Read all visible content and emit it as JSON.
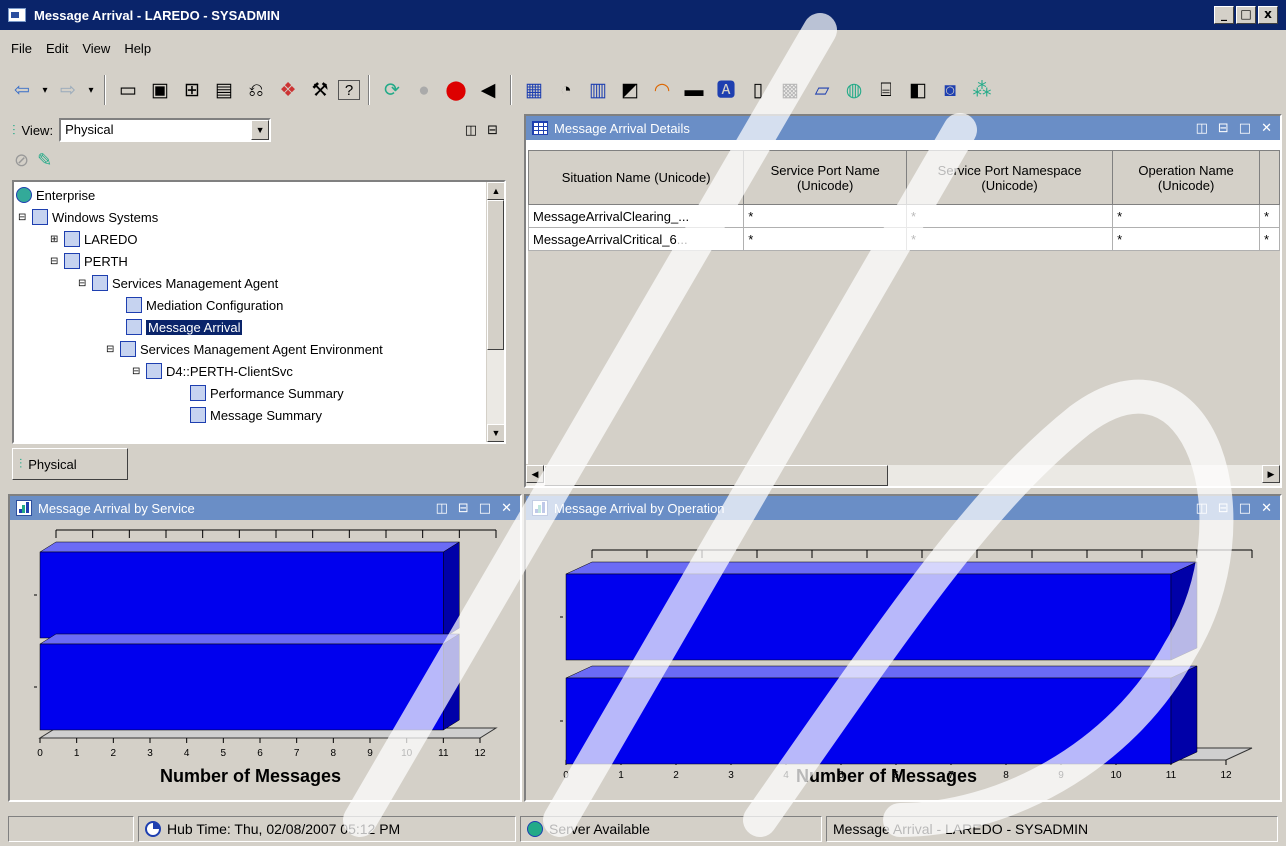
{
  "window": {
    "title": "Message Arrival - LAREDO - SYSADMIN",
    "controls": [
      "_",
      "□",
      "x"
    ]
  },
  "menu": [
    "File",
    "Edit",
    "View",
    "Help"
  ],
  "navigator": {
    "view_label": "View:",
    "view_value": "Physical",
    "tab_label": "Physical",
    "tree": [
      {
        "label": "Enterprise",
        "level": 0
      },
      {
        "label": "Windows Systems",
        "level": 1
      },
      {
        "label": "LAREDO",
        "level": 2
      },
      {
        "label": "PERTH",
        "level": 2
      },
      {
        "label": "Services Management Agent",
        "level": 3
      },
      {
        "label": "Mediation Configuration",
        "level": 4
      },
      {
        "label": "Message Arrival",
        "level": 4,
        "selected": true
      },
      {
        "label": "Services Management Agent Environment",
        "level": 4
      },
      {
        "label": "D4::PERTH-ClientSvc",
        "level": 5
      },
      {
        "label": "Performance Summary",
        "level": 6
      },
      {
        "label": "Message Summary",
        "level": 6
      }
    ]
  },
  "details": {
    "title": "Message Arrival Details",
    "columns": [
      "Situation Name (Unicode)",
      "Service Port Name (Unicode)",
      "Service Port Namespace (Unicode)",
      "Operation Name (Unicode)"
    ],
    "rows": [
      [
        "MessageArrivalClearing_...",
        "*",
        "*",
        "*",
        "*"
      ],
      [
        "MessageArrivalCritical_6...",
        "*",
        "*",
        "*",
        "*"
      ]
    ]
  },
  "chart_service": {
    "title": "Message Arrival by Service",
    "xlabel": "Number of Messages"
  },
  "chart_operation": {
    "title": "Message Arrival by Operation",
    "xlabel": "Number of Messages"
  },
  "chart_data": [
    {
      "type": "bar",
      "orientation": "horizontal",
      "title": "Message Arrival by Service",
      "xlabel": "Number of Messages",
      "xlim": [
        0,
        12
      ],
      "xticks": [
        "0",
        "1",
        "2",
        "3",
        "4",
        "5",
        "6",
        "7",
        "8",
        "9",
        "10",
        "11",
        "12"
      ],
      "categories": [
        "",
        ""
      ],
      "values": [
        11,
        11
      ]
    },
    {
      "type": "bar",
      "orientation": "horizontal",
      "title": "Message Arrival by Operation",
      "xlabel": "Number of Messages",
      "xlim": [
        0,
        12
      ],
      "xticks": [
        "0",
        "1",
        "2",
        "3",
        "4",
        "5",
        "6",
        "7",
        "8",
        "9",
        "10",
        "11",
        "12"
      ],
      "categories": [
        "",
        ""
      ],
      "values": [
        11,
        11
      ]
    }
  ],
  "status": {
    "hub_time": "Hub Time: Thu, 02/08/2007 05:12 PM",
    "server": "Server Available",
    "workspace": "Message Arrival - LAREDO - SYSADMIN"
  },
  "colors": {
    "bar_fill": "#0000ee",
    "panel_header": "#6a8ec6",
    "title_bar": "#0a246a"
  }
}
